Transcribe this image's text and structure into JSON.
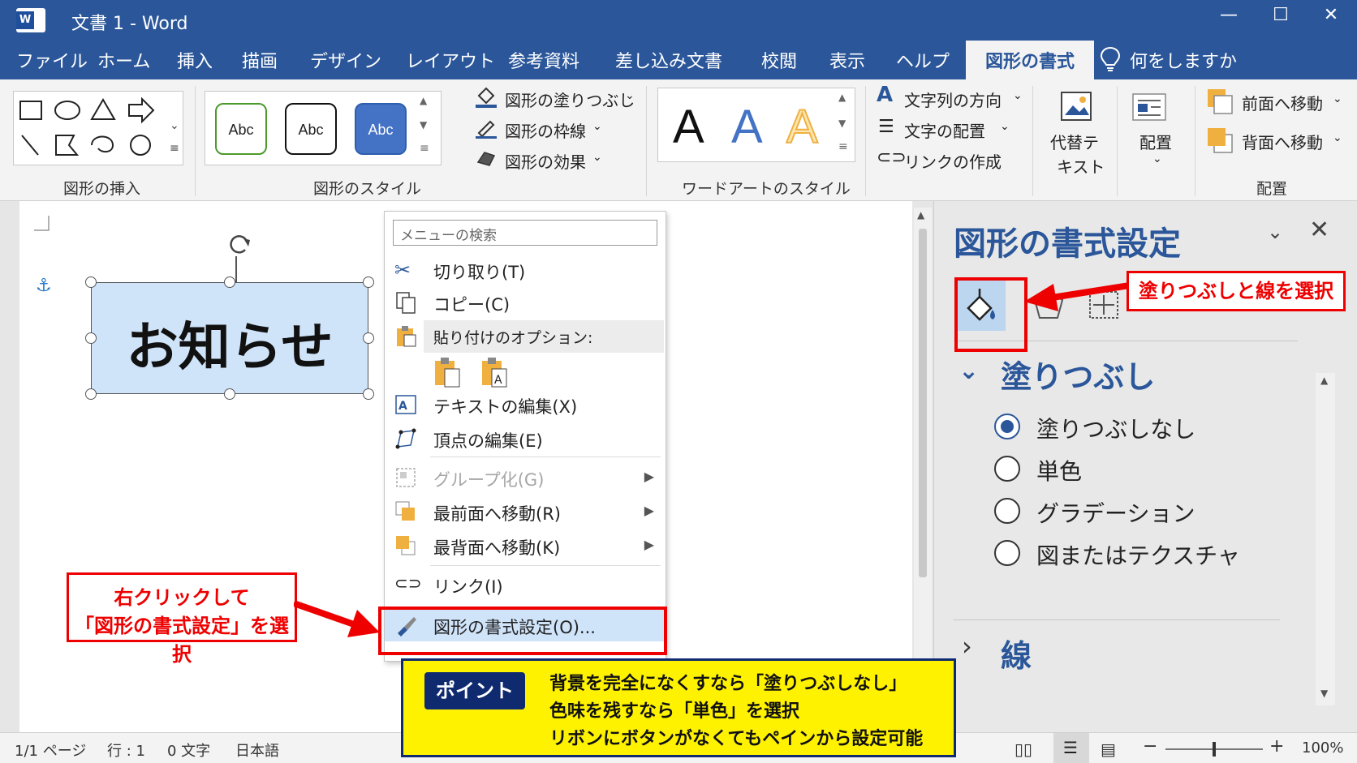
{
  "title_bar": {
    "doc_title": "文書 1  -  Word",
    "logo": "W",
    "minimize": "—",
    "maximize": "☐",
    "close": "✕"
  },
  "tabs": [
    "ファイル",
    "ホーム",
    "挿入",
    "描画",
    "デザイン",
    "レイアウト",
    "参考資料",
    "差し込み文書",
    "校閲",
    "表示",
    "ヘルプ",
    "図形の書式"
  ],
  "tell_me": "何をしますか",
  "ribbon": {
    "groups": {
      "insert_shapes": "図形の挿入",
      "shape_styles": "図形のスタイル",
      "wordart_styles": "ワードアートのスタイル",
      "arrange": "配置"
    },
    "style_samples": [
      "Abc",
      "Abc",
      "Abc"
    ],
    "shape_fill": "図形の塗りつぶし",
    "shape_outline": "図形の枠線",
    "shape_effects": "図形の効果",
    "wordart_letters": [
      "A",
      "A",
      "A"
    ],
    "text_direction": "文字列の方向",
    "align_text": "文字の配置",
    "create_link": "リンクの作成",
    "alt_text_1": "代替テ",
    "alt_text_2": "キスト",
    "position": "配置",
    "bring_forward": "前面へ移動",
    "send_backward": "背面へ移動"
  },
  "document": {
    "shape_text": "お知らせ"
  },
  "context_menu": {
    "search_placeholder": "メニューの検索",
    "items": {
      "cut": "切り取り(T)",
      "copy": "コピー(C)",
      "paste_options": "貼り付けのオプション:",
      "edit_text": "テキストの編集(X)",
      "edit_points": "頂点の編集(E)",
      "group": "グループ化(G)",
      "bring_front": "最前面へ移動(R)",
      "send_back": "最背面へ移動(K)",
      "link": "リンク(I)",
      "format_shape": "図形の書式設定(O)..."
    }
  },
  "format_pane": {
    "title": "図形の書式設定",
    "fill_section": "塗りつぶし",
    "line_section": "線",
    "fill_options": [
      "塗りつぶしなし",
      "単色",
      "グラデーション",
      "図またはテクスチャ"
    ],
    "selected_fill_option": "塗りつぶしなし"
  },
  "status_bar": {
    "page": "1/1 ページ",
    "line": "行 : 1",
    "words": "0 文字",
    "language": "日本語",
    "zoom": "100%"
  },
  "annotations": {
    "pane_callout": "塗りつぶしと線を選択",
    "menu_callout_1": "右クリックして",
    "menu_callout_2": "「図形の書式設定」を選択",
    "point_tag": "ポイント",
    "point_lines": [
      "背景を完全になくすなら「塗りつぶしなし」",
      "色味を残すなら「単色」を選択",
      "リボンにボタンがなくてもペインから設定可能"
    ]
  },
  "colors": {
    "word_blue": "#2b579a",
    "shape_fill": "#cfe3f9",
    "callout_red": "#e00000",
    "point_yellow": "#fff200",
    "point_navy": "#0f2a6e"
  }
}
